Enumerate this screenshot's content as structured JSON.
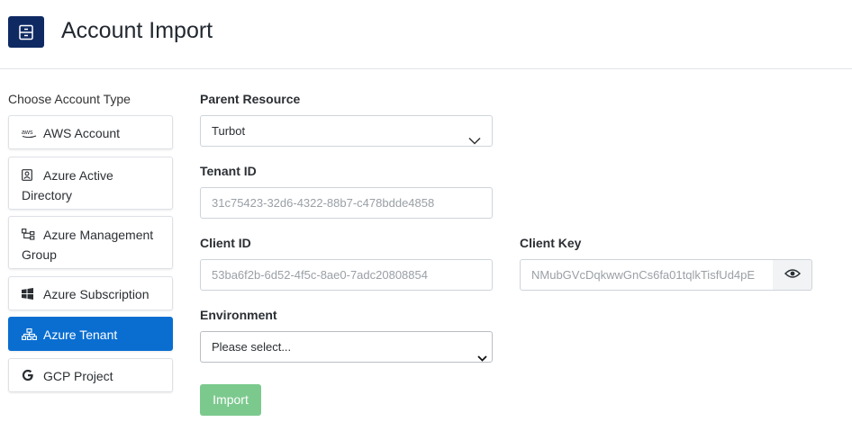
{
  "header": {
    "title": "Account Import",
    "logo_icon": "archive-icon",
    "logo_color": "#0f2a63"
  },
  "sidebar": {
    "label": "Choose Account Type",
    "items": [
      {
        "label": "AWS Account",
        "icon": "aws-icon"
      },
      {
        "label": "Azure Active Directory",
        "icon": "user-badge-icon"
      },
      {
        "label": "Azure Management Group",
        "icon": "hierarchy-icon"
      },
      {
        "label": "Azure Subscription",
        "icon": "windows-icon"
      },
      {
        "label": "Azure Tenant",
        "icon": "sitemap-icon",
        "active": true
      },
      {
        "label": "GCP Project",
        "icon": "google-icon"
      }
    ],
    "active_color": "#0a6ed1"
  },
  "form": {
    "parent_resource": {
      "label": "Parent Resource",
      "value": "Turbot"
    },
    "tenant_id": {
      "label": "Tenant ID",
      "placeholder": "31c75423-32d6-4322-88b7-c478bdde4858"
    },
    "client_id": {
      "label": "Client ID",
      "placeholder": "53ba6f2b-6d52-4f5c-8ae0-7adc20808854"
    },
    "client_key": {
      "label": "Client Key",
      "placeholder": "NMubGVcDqkwwGnCs6fa01tqlkTisfUd4pE",
      "toggle_icon": "eye-icon"
    },
    "environment": {
      "label": "Environment",
      "value": "Please select..."
    },
    "import_label": "Import",
    "import_color": "#7cc98e"
  }
}
